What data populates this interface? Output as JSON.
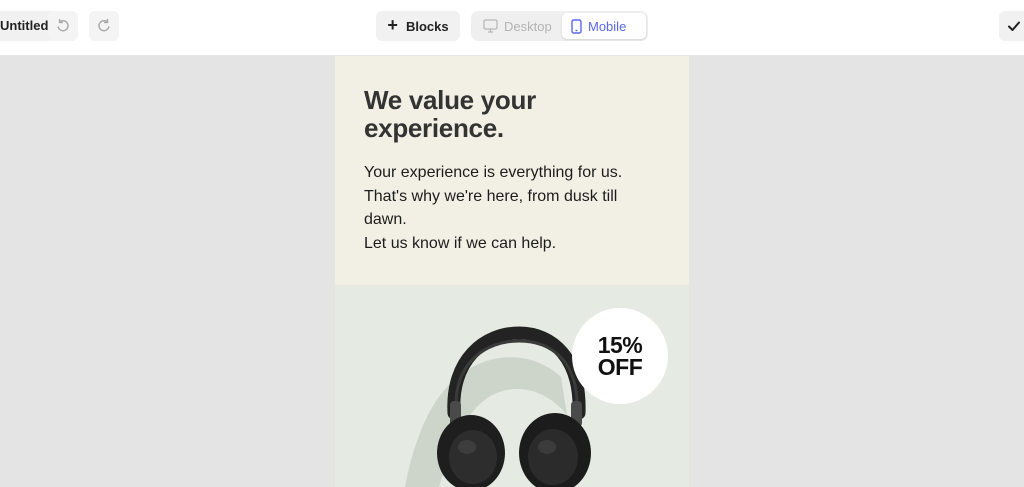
{
  "toolbar": {
    "title_label": "Untitled",
    "undo_icon": "undo-icon",
    "redo_icon": "redo-icon",
    "blocks_label": "Blocks",
    "view_desktop_label": "Desktop",
    "view_mobile_label": "Mobile",
    "active_view": "Mobile",
    "confirm_icon": "check-icon"
  },
  "email": {
    "heading": "We value your experience.",
    "body_lines": [
      "Your experience is everything for us.",
      "That's why we're here, from dusk till dawn.",
      "Let us know if we can help."
    ],
    "badge_line1": "15%",
    "badge_line2": "OFF",
    "product_image": "headphones-image"
  },
  "colors": {
    "accent": "#5b67e8",
    "hero_bg": "#f2f0e5",
    "product_bg": "#e5ebe3",
    "canvas_bg": "#e4e4e4"
  }
}
